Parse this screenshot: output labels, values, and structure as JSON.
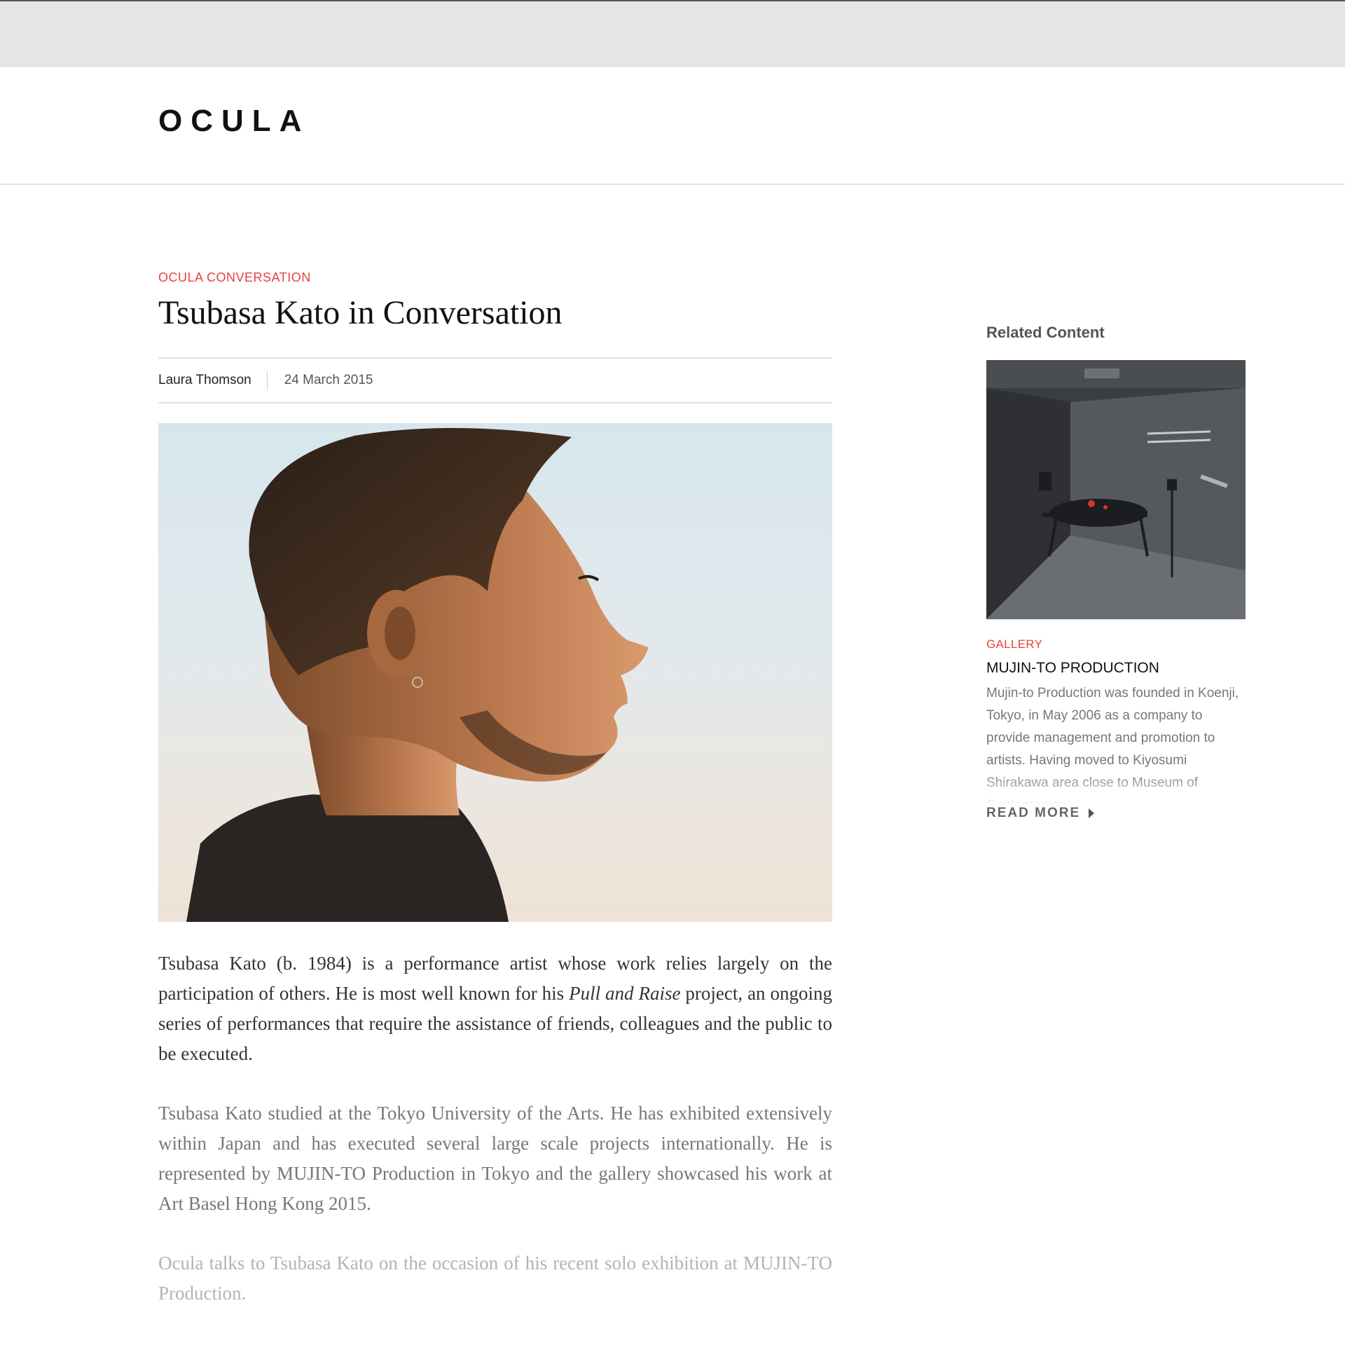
{
  "header": {
    "logo": "OCULA"
  },
  "article": {
    "kicker": "OCULA CONVERSATION",
    "title": "Tsubasa Kato in Conversation",
    "author": "Laura Thomson",
    "date": "24 March 2015",
    "paragraphs": {
      "p1_a": "Tsubasa Kato (b. 1984) is a performance artist whose work relies largely on the participation of others. He is most well known for his ",
      "p1_italic": "Pull and Raise",
      "p1_b": " project, an ongoing series of performances that require the assistance of friends, colleagues and the public to be executed.",
      "p2": "Tsubasa Kato studied at the Tokyo University of the Arts. He has exhibited extensively within Japan and has executed several large scale projects internationally. He is represented by MUJIN-TO Production in Tokyo and the gallery showcased his work at Art Basel Hong Kong 2015.",
      "p3": "Ocula talks to Tsubasa Kato on the occasion of his recent solo exhibition at MUJIN-TO Production."
    }
  },
  "sidebar": {
    "heading": "Related Content",
    "card": {
      "kicker": "GALLERY",
      "title": "MUJIN-TO PRODUCTION",
      "description": "Mujin-to Production was founded in Koenji, Tokyo, in May 2006 as a company to provide management and promotion to artists. Having moved to Kiyosumi Shirakawa area close to Museum of Contemporary",
      "read_more": "READ MORE"
    }
  },
  "colors": {
    "accent": "#e8403c",
    "header_strip": "#e5e5e5"
  },
  "icons": {
    "read_more": "caret-right-icon"
  }
}
